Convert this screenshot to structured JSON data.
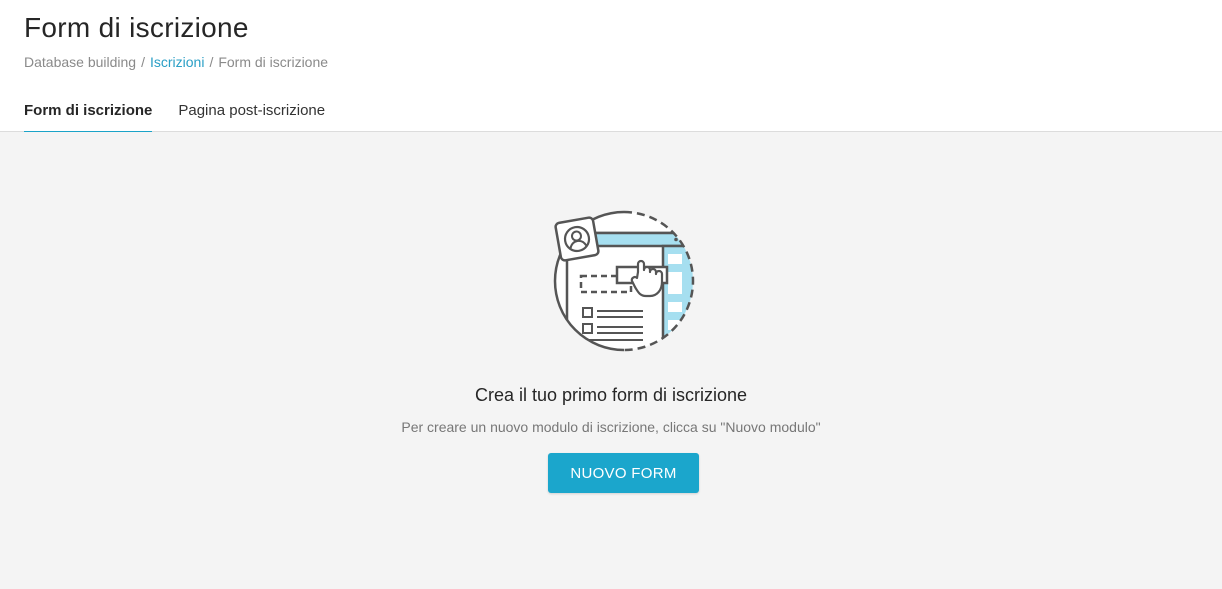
{
  "header": {
    "title": "Form di iscrizione",
    "breadcrumb": {
      "items": [
        "Database building",
        "Iscrizioni",
        "Form di iscrizione"
      ],
      "separator": "/"
    },
    "tabs": [
      {
        "label": "Form di iscrizione",
        "active": true
      },
      {
        "label": "Pagina post-iscrizione",
        "active": false
      }
    ]
  },
  "empty_state": {
    "illustration_icon": "signup-form-illustration-icon",
    "title": "Crea il tuo primo form di iscrizione",
    "subtitle": "Per creare un nuovo modulo di iscrizione, clicca su \"Nuovo modulo\"",
    "button_label": "NUOVO FORM"
  },
  "colors": {
    "accent": "#1ba6cc",
    "link": "#2a9fc6",
    "content_bg": "#f4f4f4"
  }
}
